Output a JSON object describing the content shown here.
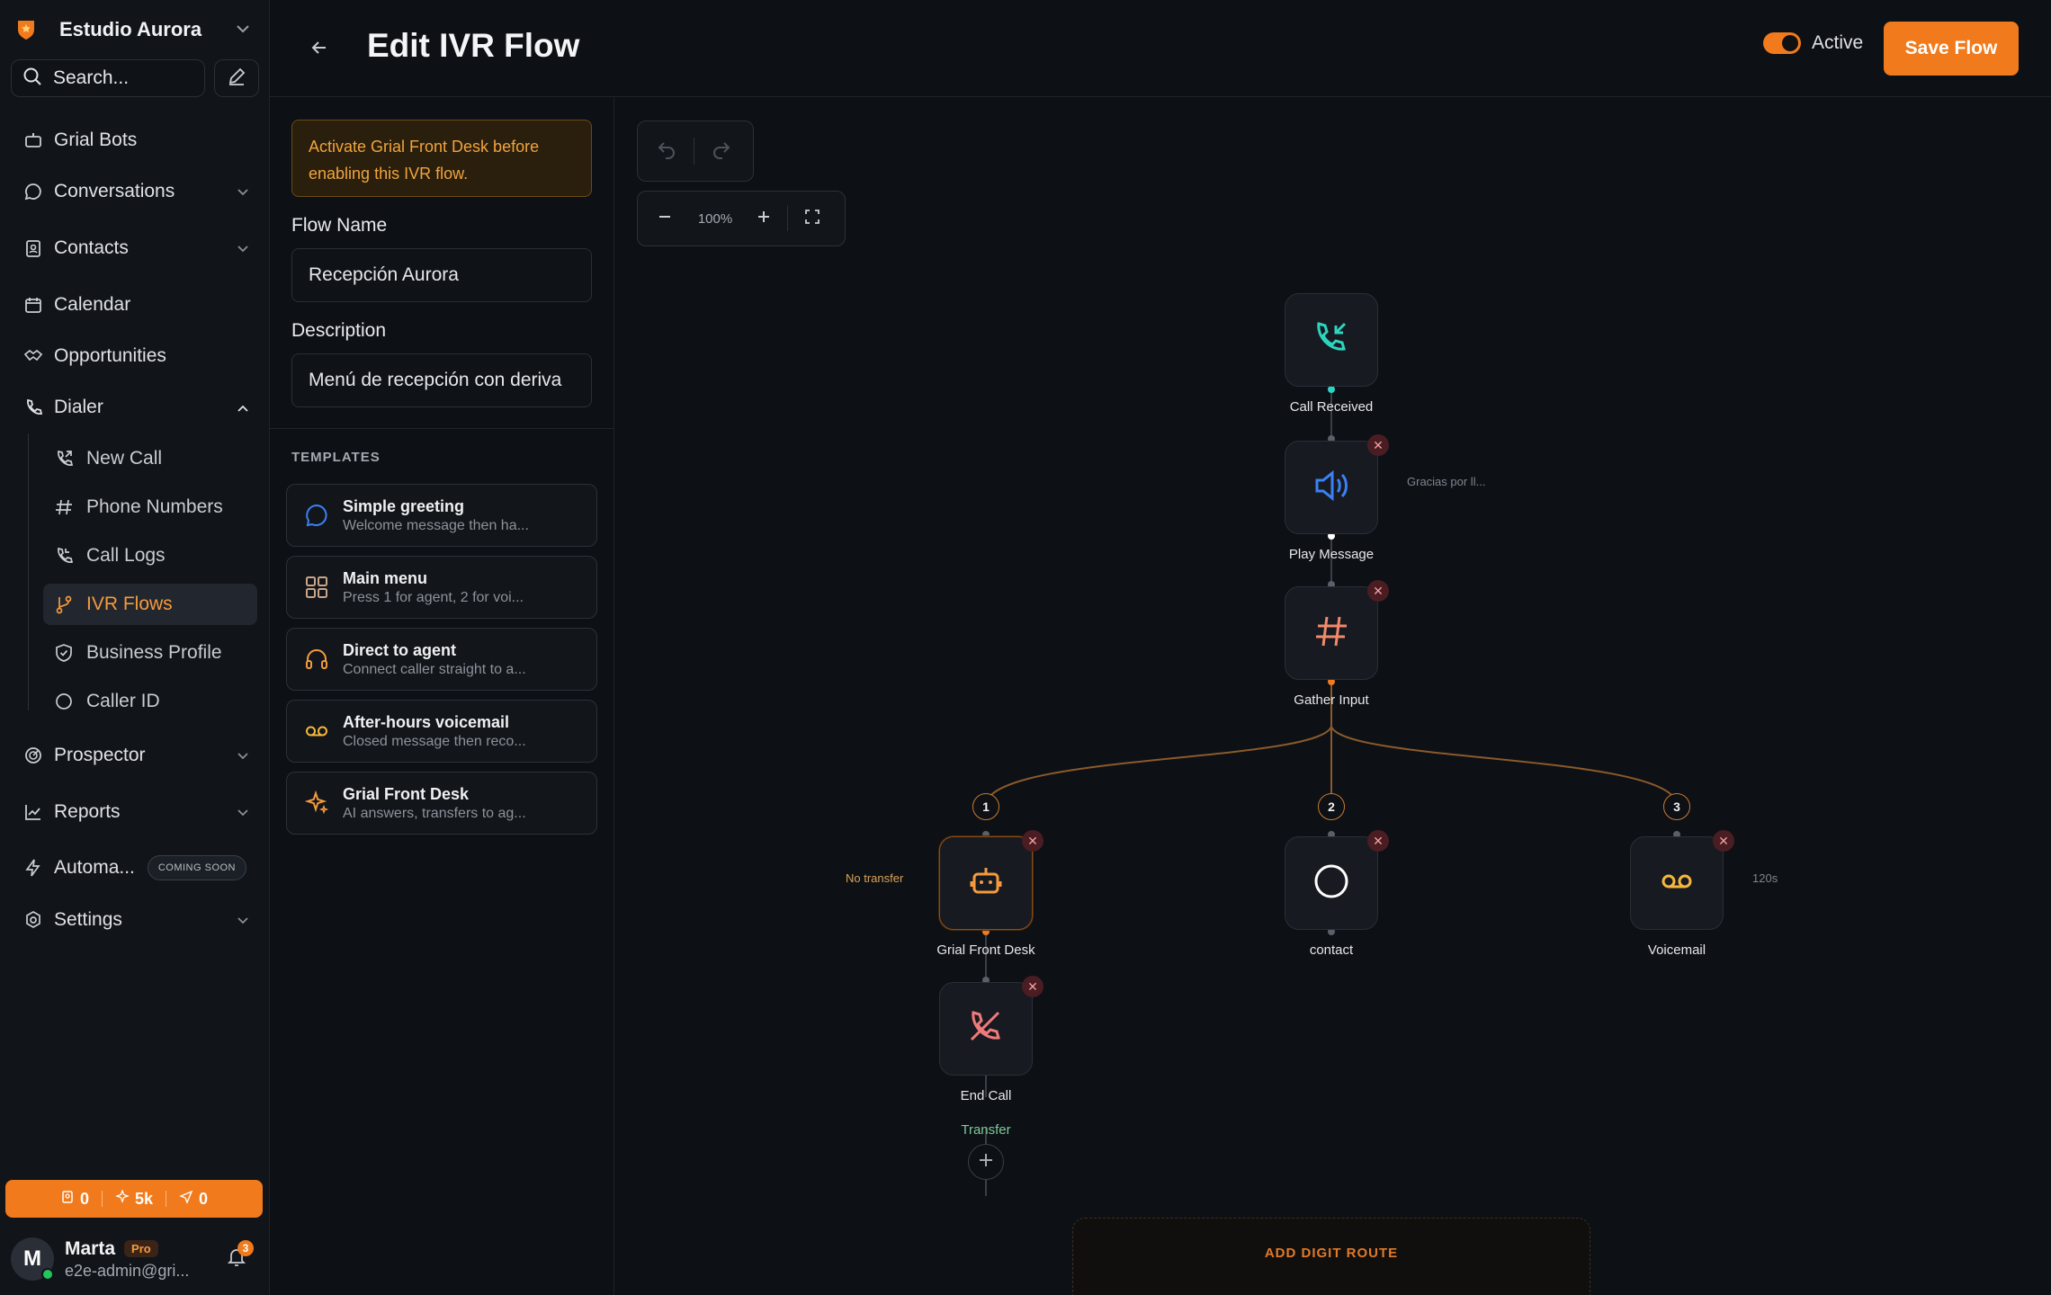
{
  "workspace": {
    "name": "Estudio Aurora"
  },
  "search": {
    "label": "Search..."
  },
  "nav": {
    "grial_bots": "Grial Bots",
    "conversations": "Conversations",
    "contacts": "Contacts",
    "calendar": "Calendar",
    "opportunities": "Opportunities",
    "dialer": "Dialer",
    "dialer_sub": {
      "new_call": "New Call",
      "phone_numbers": "Phone Numbers",
      "call_logs": "Call Logs",
      "ivr_flows": "IVR Flows",
      "business_profile": "Business Profile",
      "caller_id": "Caller ID"
    },
    "prospector": "Prospector",
    "reports": "Reports",
    "automations": "Automa...",
    "automations_badge": "COMING SOON",
    "settings": "Settings"
  },
  "credits": {
    "contacts": "0",
    "ai": "5k",
    "sends": "0"
  },
  "user": {
    "initial": "M",
    "name": "Marta",
    "plan": "Pro",
    "email": "e2e-admin@gri...",
    "notifications": "3"
  },
  "header": {
    "title": "Edit IVR Flow",
    "active_label": "Active",
    "save_label": "Save Flow"
  },
  "form": {
    "warning": "Activate Grial Front Desk before enabling this IVR flow.",
    "flow_name_label": "Flow Name",
    "flow_name_value": "Recepción Aurora",
    "description_label": "Description",
    "description_value": "Menú de recepción con deriva"
  },
  "templates": {
    "heading": "TEMPLATES",
    "items": [
      {
        "title": "Simple greeting",
        "subtitle": "Welcome message then ha..."
      },
      {
        "title": "Main menu",
        "subtitle": "Press 1 for agent, 2 for voi..."
      },
      {
        "title": "Direct to agent",
        "subtitle": "Connect caller straight to a..."
      },
      {
        "title": "After-hours voicemail",
        "subtitle": "Closed message then reco..."
      },
      {
        "title": "Grial Front Desk",
        "subtitle": "AI answers, transfers to ag..."
      }
    ]
  },
  "canvas": {
    "zoom": "100%",
    "nodes": {
      "call_received": "Call Received",
      "play_message": "Play Message",
      "play_message_note": "Gracias por ll...",
      "gather_input": "Gather Input",
      "front_desk": "Grial Front Desk",
      "front_desk_note": "No transfer",
      "contact": "contact",
      "voicemail": "Voicemail",
      "voicemail_note": "120s",
      "end_call": "End Call",
      "transfer": "Transfer"
    },
    "digits": [
      "1",
      "2",
      "3"
    ],
    "add_route": "ADD DIGIT ROUTE"
  },
  "colors": {
    "accent": "#f07a1c",
    "teal": "#2dd4bf",
    "blue": "#3b82f6",
    "danger": "#4a1d22"
  }
}
